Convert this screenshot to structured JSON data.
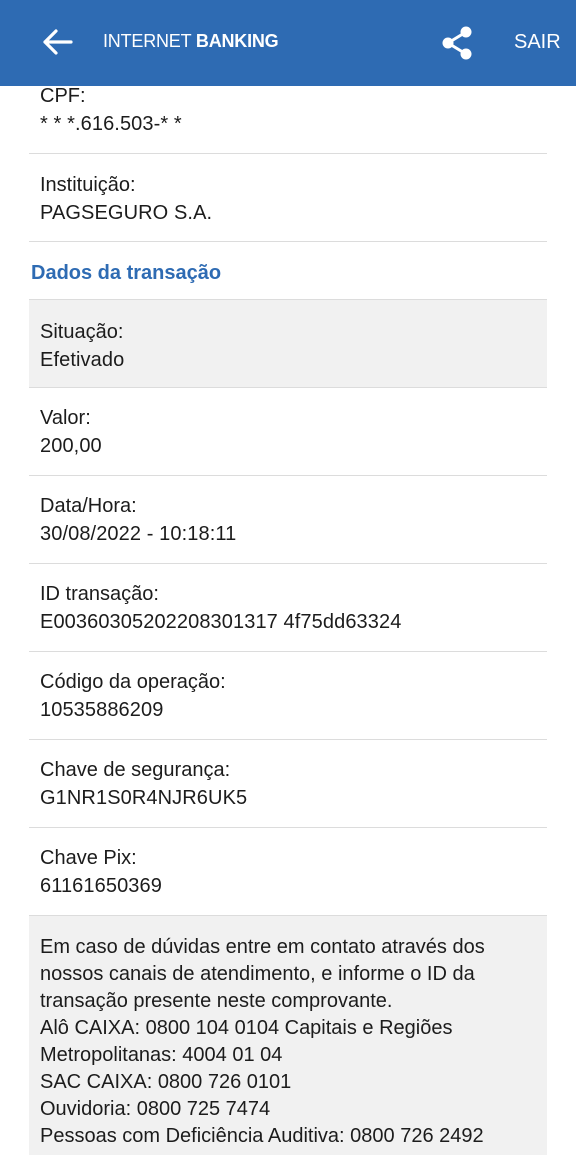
{
  "header": {
    "brand_light": "INTERNET ",
    "brand_bold": "BANKING",
    "exit_label": "SAIR",
    "bg_color": "#2e6bb3"
  },
  "recipient": {
    "cpf_label": "CPF:",
    "cpf_value": "* * *.616.503-* *",
    "institution_label": "Instituição:",
    "institution_value": "PAGSEGURO S.A."
  },
  "transaction": {
    "section_title": "Dados da transação",
    "fields": [
      {
        "label": "Situação:",
        "value": "Efetivado"
      },
      {
        "label": "Valor:",
        "value": "200,00"
      },
      {
        "label": "Data/Hora:",
        "value": "30/08/2022 - 10:18:11"
      },
      {
        "label": "ID transação:",
        "value": "E00360305202208301317 4f75dd63324"
      },
      {
        "label": "Código da operação:",
        "value": "10535886209"
      },
      {
        "label": "Chave de segurança:",
        "value": "G1NR1S0R4NJR6UK5"
      },
      {
        "label": "Chave Pix:",
        "value": "61161650369"
      }
    ]
  },
  "info": {
    "lines": [
      "Em caso de dúvidas entre em contato através dos",
      "nossos canais de atendimento, e informe o ID da",
      "transação presente neste comprovante.",
      "Alô CAIXA: 0800 104 0104 Capitais e Regiões",
      "Metropolitanas: 4004 01 04",
      "SAC CAIXA: 0800 726 0101",
      "Ouvidoria: 0800 725 7474",
      "Pessoas com Deficiência Auditiva: 0800 726 2492"
    ]
  },
  "icons": {
    "back": "arrow-left-icon",
    "share": "share-icon"
  }
}
